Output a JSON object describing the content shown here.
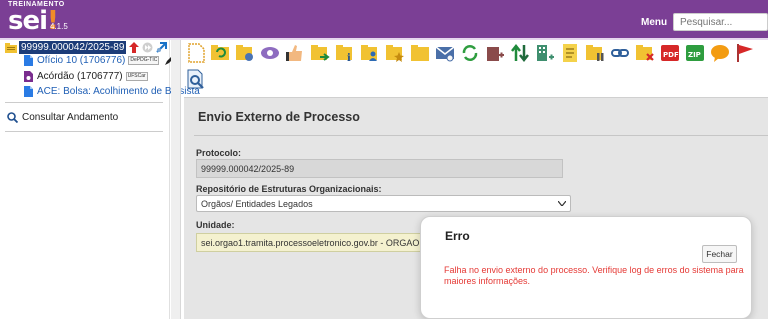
{
  "header": {
    "environment": "TREINAMENTO",
    "logo": "sei",
    "version": "4.1.5",
    "menu_label": "Menu",
    "search_placeholder": "Pesquisar..."
  },
  "sidebar": {
    "process_number": "99999.000042/2025-89",
    "documents": [
      {
        "label": "Ofício 10 (1706776)",
        "badge": "DePDG-TIC"
      },
      {
        "label": "Acórdão (1706777)",
        "badge": "UFSCar"
      },
      {
        "label": "ACE: Bolsa: Acolhimento de Bolsista",
        "badge": ""
      }
    ],
    "consult_label": "Consultar Andamento"
  },
  "toolbar": {
    "icons": [
      "new-document-icon",
      "update-process-icon",
      "edit-process-icon",
      "visualization-icon",
      "assign-process-icon",
      "send-process-icon",
      "process-info-icon",
      "process-assignee-icon",
      "favorite-process-icon",
      "open-folder-icon",
      "send-email-icon",
      "relate-process-icon",
      "reopen-process-icon",
      "transfer-icon",
      "org-chart-icon",
      "annotation-icon",
      "suspend-process-icon",
      "link-icon",
      "remove-folder-icon",
      "pdf-icon",
      "zip-icon",
      "comments-icon",
      "flag-icon",
      "search-in-process-icon"
    ]
  },
  "form": {
    "title": "Envio Externo de Processo",
    "protocol_label": "Protocolo:",
    "protocol_value": "99999.000042/2025-89",
    "repository_label": "Repositório de Estruturas Organizacionais:",
    "repository_value": "Orgãos/ Entidades Legados",
    "unit_label": "Unidade:",
    "unit_value": "sei.orgao1.tramita.processoeletronico.gov.br - ORGAO1"
  },
  "modal": {
    "title": "Erro",
    "close_label": "Fechar",
    "message": "Falha no envio externo do processo. Verifique log de erros do sistema para maiores informações."
  },
  "colors": {
    "header_purple": "#7b3f95",
    "selected_process_bg": "#1c3c78",
    "error_red": "#e53935",
    "link_blue": "#1f5fb5"
  }
}
